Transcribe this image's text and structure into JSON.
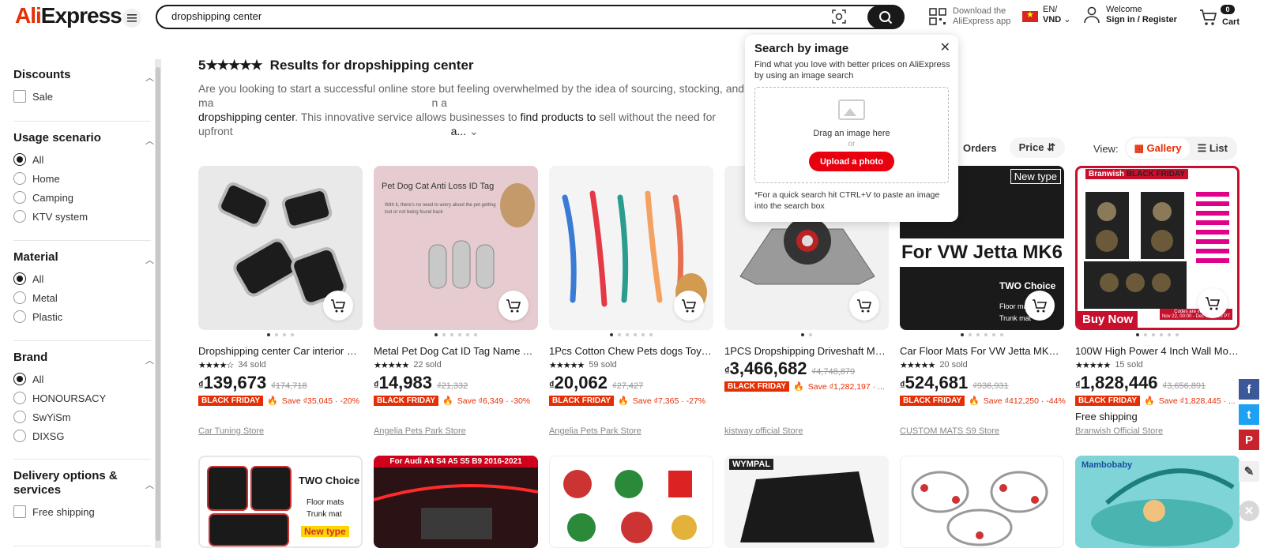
{
  "header": {
    "logo_part1": "Ali",
    "logo_part2": "Express",
    "search_value": "dropshipping center",
    "app_line1": "Download the",
    "app_line2": "AliExpress app",
    "lang_line1": "EN/",
    "lang_line2": "VND",
    "user_line1": "Welcome",
    "user_line2": "Sign in / Register",
    "cart_count": "0",
    "cart_label": "Cart"
  },
  "filters": {
    "discounts": {
      "title": "Discounts",
      "options": [
        "Sale"
      ]
    },
    "usage": {
      "title": "Usage scenario",
      "options": [
        "All",
        "Home",
        "Camping",
        "KTV system"
      ]
    },
    "material": {
      "title": "Material",
      "options": [
        "All",
        "Metal",
        "Plastic"
      ]
    },
    "brand": {
      "title": "Brand",
      "options": [
        "All",
        "HONOURSACY",
        "SwYiSm",
        "DIXSG"
      ]
    },
    "delivery": {
      "title": "Delivery options & services",
      "options": [
        "Free shipping"
      ]
    }
  },
  "results": {
    "rating": "5",
    "title": "Results for dropshipping center",
    "desc_part1": "Are you looking to start a successful online store but feeling overwhelmed by the idea of sourcing, stocking, and ma",
    "desc_part1_tail": "n a",
    "desc_part2a": "dropshipping center",
    "desc_part2b": ". This innovative service allows businesses to ",
    "desc_part2c": "find products to",
    "desc_part2d": " sell without the need for upfront",
    "desc_part2_tail": "a..."
  },
  "sort": {
    "orders": "Orders",
    "price": "Price",
    "view_label": "View:",
    "gallery": "Gallery",
    "list": "List"
  },
  "popup": {
    "title": "Search by image",
    "subtitle": "Find what you love with better prices on AliExpress by using an image search",
    "drag": "Drag an image here",
    "or": "or",
    "upload": "Upload a photo",
    "note": "*For a quick search hit CTRL+V to paste an image into the search box"
  },
  "products": [
    {
      "title": "Dropshipping center Car interior ac...",
      "stars": "★★★★☆",
      "sold": "34 sold",
      "currency": "₫",
      "price": "139,673",
      "old": "₫174,718",
      "bf": "BLACK FRIDAY",
      "save": "Save ₫35,045 · -20%",
      "store": "Car Tuning Store",
      "shipping": ""
    },
    {
      "title": "Metal Pet Dog Cat ID Tag Name Ad...",
      "stars": "★★★★★",
      "sold": "22 sold",
      "currency": "₫",
      "price": "14,983",
      "old": "₫21,332",
      "bf": "BLACK FRIDAY",
      "save": "Save ₫6,349 · -30%",
      "store": "Angelia Pets Park Store",
      "shipping": ""
    },
    {
      "title": "1Pcs Cotton Chew Pets dogs Toys P...",
      "stars": "★★★★★",
      "sold": "59 sold",
      "currency": "₫",
      "price": "20,062",
      "old": "₫27,427",
      "bf": "BLACK FRIDAY",
      "save": "Save ₫7,365 · -27%",
      "store": "Angelia Pets Park Store",
      "shipping": ""
    },
    {
      "title": "1PCS Dropshipping Driveshaft Mou...",
      "stars": "",
      "sold": "",
      "currency": "₫",
      "price": "3,466,682",
      "old": "₫4,748,879",
      "bf": "BLACK FRIDAY",
      "save": "Save ₫1,282,197 · ...",
      "store": "kistway official Store",
      "shipping": ""
    },
    {
      "title": "Car Floor Mats For VW Jetta MK6 20...",
      "stars": "★★★★★",
      "sold": "20 sold",
      "currency": "₫",
      "price": "524,681",
      "old": "₫936,931",
      "bf": "BLACK FRIDAY",
      "save": "Save ₫412,250 · -44%",
      "store": "CUSTOM MATS S9 Store",
      "shipping": ""
    },
    {
      "title": "100W High Power 4 Inch Wall Moun...",
      "stars": "★★★★★",
      "sold": "15 sold",
      "currency": "₫",
      "price": "1,828,446",
      "old": "₫3,656,891",
      "bf": "BLACK FRIDAY",
      "save": "Save ₫1,828,445 · ...",
      "store": "Branwish Official Store",
      "shipping": "Free shipping"
    }
  ],
  "image_text": {
    "p2_tag": "Pet Dog Cat Anti Loss ID Tag",
    "p2_sub": "With it, there's no need to worry about the pet getting lost or not being found back",
    "p5_new": "New type",
    "p5_main": "For VW Jetta MK6",
    "p5_two": "TWO Choice",
    "p5_floor": "Floor mats",
    "p5_trunk": "Trunk mat",
    "p6_brand": "Branwish",
    "p6_bf": "BLACK FRIDAY",
    "p6_buy": "Buy Now",
    "p6_codes": "Codes are valid from",
    "p6_dates": "Nov 22, 00:00 - Dec 3, 23:59 PT",
    "r2_1_two": "TWO Choice",
    "r2_1_floor": "Floor mats",
    "r2_1_trunk": "Trunk mat",
    "r2_1_new": "New type",
    "r2_2_head": "For Audi A4 S4 A5 S5 B9 2016-2021",
    "r2_4_brand": "WYMPAL",
    "r2_6_brand": "Mambobaby"
  },
  "colors": {
    "brand": "#e62e04",
    "sale": "#e62e04",
    "dark": "#191919"
  }
}
